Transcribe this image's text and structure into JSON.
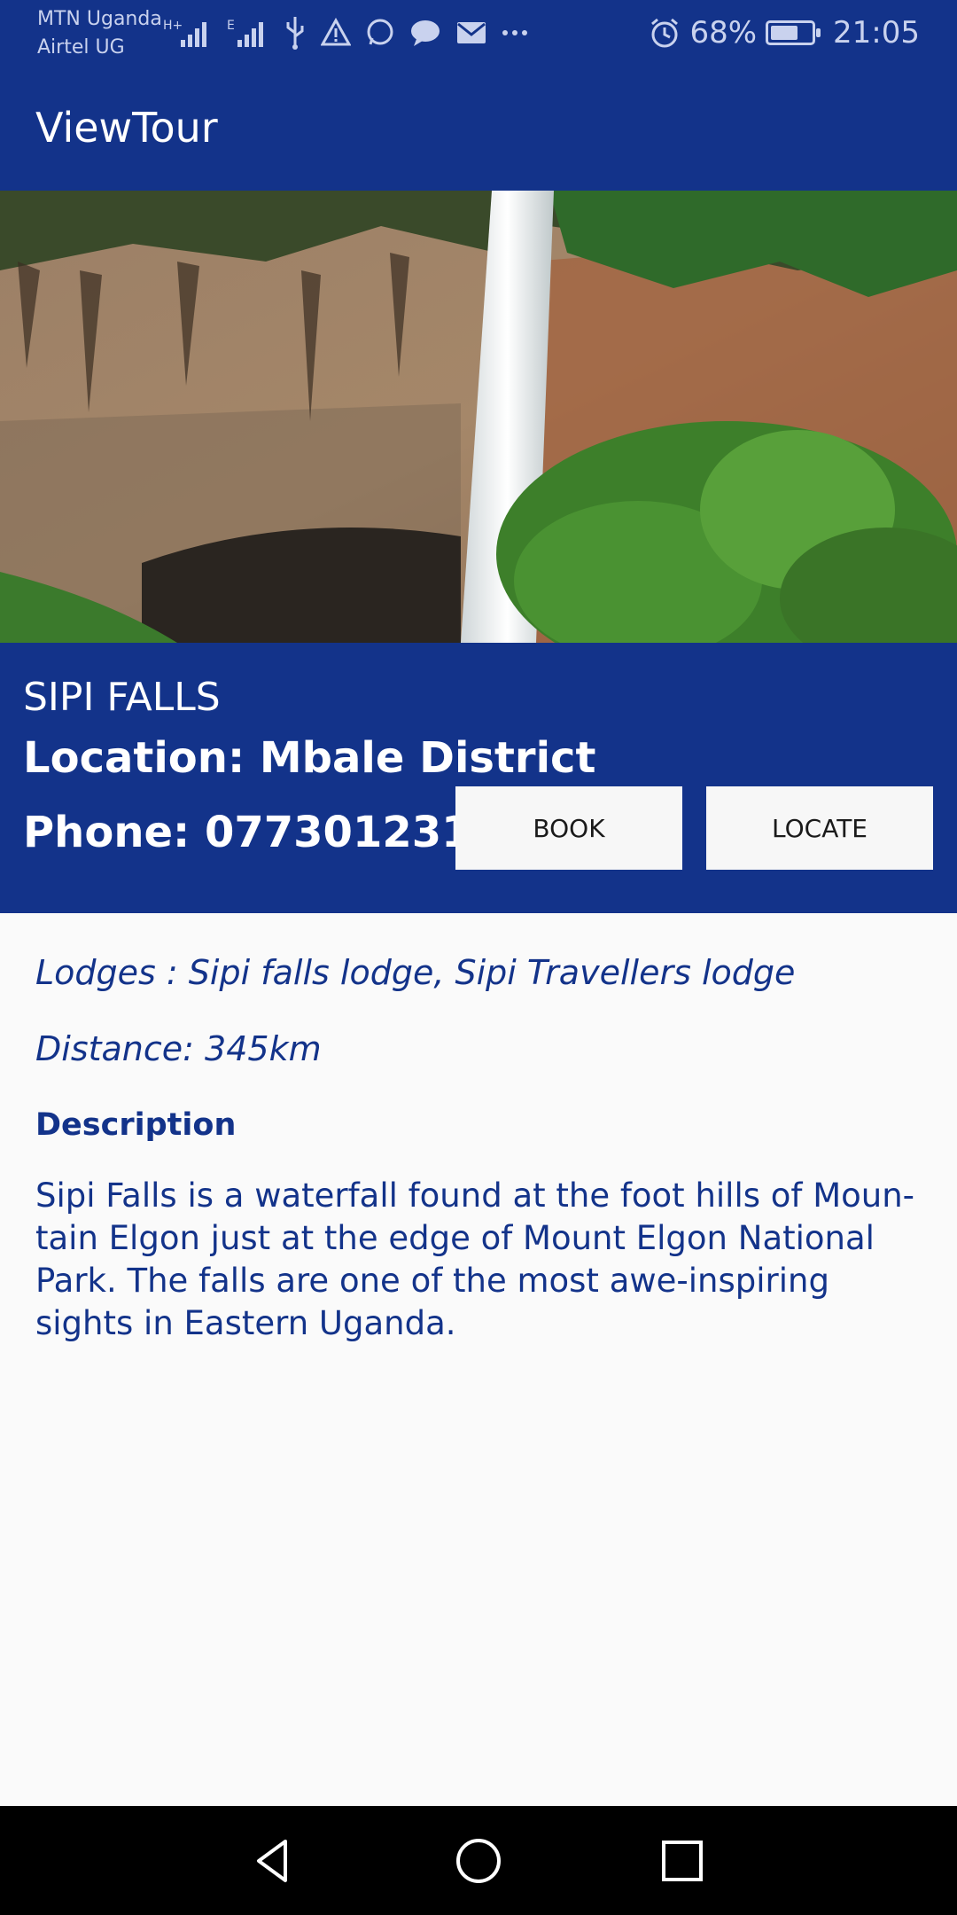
{
  "status_bar": {
    "carrier_1": "MTN Uganda",
    "carrier_2": "Airtel UG",
    "battery": "68%",
    "battery_level": 0.68,
    "time": "21:05",
    "icons": [
      "hplus-signal-icon",
      "signal-icon",
      "e-signal-icon",
      "usb-icon",
      "warning-icon",
      "whatsapp-icon",
      "message-icon",
      "mail-icon",
      "more-icon",
      "alarm-icon",
      "battery-charging-icon"
    ]
  },
  "app_bar": {
    "title": "ViewTour"
  },
  "hero": {
    "image": "waterfall-photo"
  },
  "place": {
    "name": "SIPI FALLS",
    "location": "Location: Mbale District",
    "phone": "Phone: 0773012311",
    "book_label": "BOOK",
    "locate_label": "LOCATE"
  },
  "details": {
    "lodges": "Lodges : Sipi falls lodge, Sipi Travellers lodge",
    "distance": "Distance: 345km",
    "description_heading": "Description",
    "description": "Sipi Falls is a waterfall found at the foot hills of Moun-tain Elgon just at the edge of Mount Elgon National Park. The falls are one of the most awe-inspiring sights in Eastern Uganda."
  },
  "nav_bar": {
    "icons": [
      "back-icon",
      "home-icon",
      "recents-icon"
    ]
  },
  "colors": {
    "primary": "#13338a",
    "text_dark_blue": "#13338a",
    "button_bg": "#f7f7f7",
    "background": "#fafafa"
  }
}
